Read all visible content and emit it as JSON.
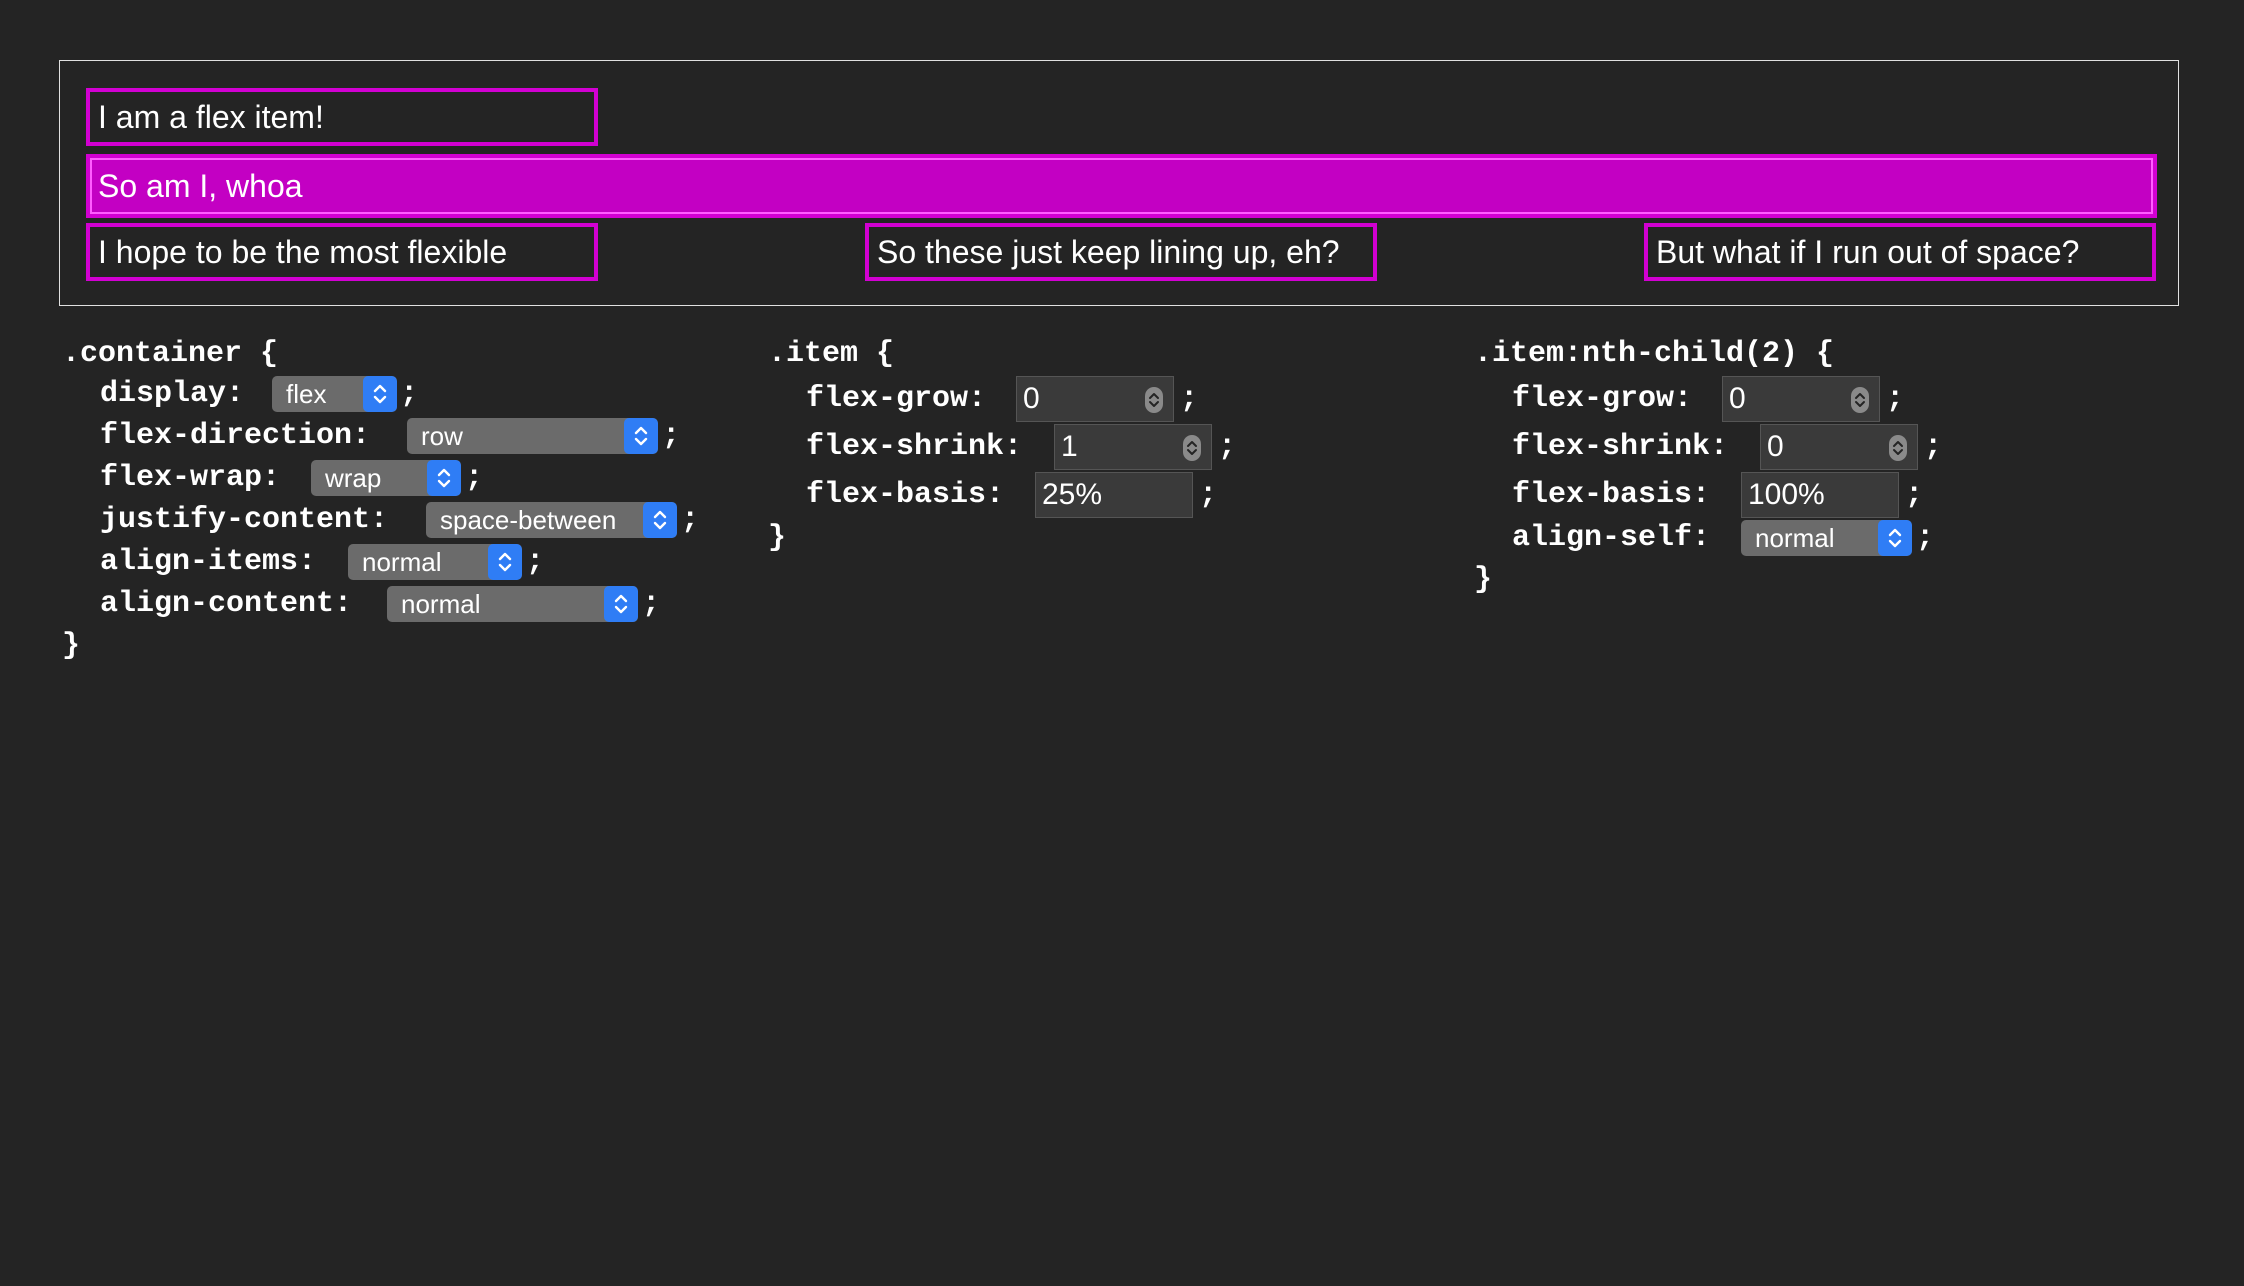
{
  "flex_items": [
    "I am a flex item!",
    "So am I, whoa",
    "I hope to be the most flexible",
    "So these just keep lining up, eh?",
    "But what if I run out of space?"
  ],
  "container_rule": {
    "selector": ".container {",
    "props": [
      {
        "name": "display:",
        "value": "flex"
      },
      {
        "name": "flex-direction:",
        "value": "row"
      },
      {
        "name": "flex-wrap:",
        "value": "wrap"
      },
      {
        "name": "justify-content:",
        "value": "space-between"
      },
      {
        "name": "align-items:",
        "value": "normal"
      },
      {
        "name": "align-content:",
        "value": "normal"
      }
    ],
    "close": "}"
  },
  "item_rule": {
    "selector": ".item {",
    "props": [
      {
        "name": "flex-grow:",
        "value": "0"
      },
      {
        "name": "flex-shrink:",
        "value": "1"
      },
      {
        "name": "flex-basis:",
        "value": "25%"
      }
    ],
    "close": "}"
  },
  "nth_rule": {
    "selector": ".item:nth-child(2) {",
    "props": [
      {
        "name": "flex-grow:",
        "value": "0"
      },
      {
        "name": "flex-shrink:",
        "value": "0"
      },
      {
        "name": "flex-basis:",
        "value": "100%"
      },
      {
        "name": "align-self:",
        "value": "normal"
      }
    ],
    "close": "}"
  },
  "semicolon": ";",
  "icons": {
    "select_arrow": "chevron-up-down-icon",
    "spinner": "stepper-icon"
  },
  "colors": {
    "background": "#242424",
    "item_border": "#d200d2",
    "item_fill": "#c300c3",
    "select_accent": "#2f7df5"
  }
}
